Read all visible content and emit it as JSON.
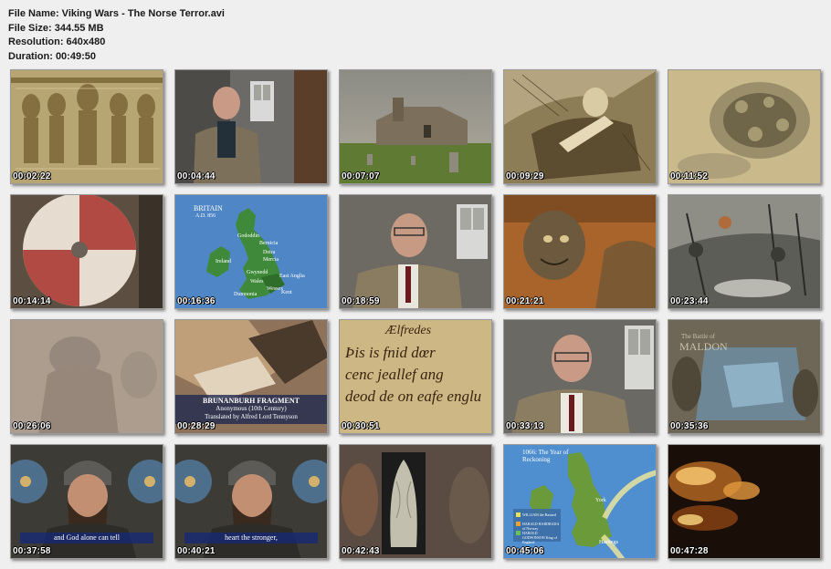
{
  "info": {
    "file_name": "File Name: Viking Wars - The Norse Terror.avi",
    "file_size": "File Size: 344.55 MB",
    "resolution": "Resolution: 640x480",
    "duration": "Duration: 00:49:50"
  },
  "thumbnails": [
    {
      "time": "00:02:22"
    },
    {
      "time": "00:04:44"
    },
    {
      "time": "00:07:07"
    },
    {
      "time": "00:09:29"
    },
    {
      "time": "00:11:52"
    },
    {
      "time": "00:14:14"
    },
    {
      "time": "00:16:36",
      "map_title": "BRITAIN",
      "map_year": "A.D. 856",
      "labels": [
        "Gododdin",
        "Bernicia",
        "Deira",
        "Mercia",
        "Ireland",
        "Gwynedd",
        "East Anglia",
        "Wales",
        "Wessex",
        "Kent",
        "Dumnonia"
      ]
    },
    {
      "time": "00:18:59"
    },
    {
      "time": "00:21:21"
    },
    {
      "time": "00:23:44"
    },
    {
      "time": "00:26:06"
    },
    {
      "time": "00:28:29",
      "caption_title": "BRUNANBURH FRAGMENT",
      "caption_line1": "Anonymous (10th Century)",
      "caption_line2": "Translated by Alfred Lord Tennyson"
    },
    {
      "time": "00:30:51",
      "ms_line1": "Ælfredes",
      "ms_line2": "Þis is fnid dœr",
      "ms_line3": "cenc jeallef ang",
      "ms_line4": "deod de on eafe englu"
    },
    {
      "time": "00:33:13"
    },
    {
      "time": "00:35:36",
      "title_line1": "The Battle of",
      "title_line2": "MALDON"
    },
    {
      "time": "00:37:58",
      "subtitle": "and God alone can tell"
    },
    {
      "time": "00:40:21",
      "subtitle": "heart the stronger,"
    },
    {
      "time": "00:42:43"
    },
    {
      "time": "00:45:06",
      "map_title": "1066: The Year of Reckoning",
      "legend": [
        "WILLIAM the Bastard",
        "HARALD HARDRADA of Norway",
        "HAROLD GODWINSON King of England"
      ],
      "places": [
        "York",
        "Hastings"
      ]
    },
    {
      "time": "00:47:28"
    }
  ]
}
